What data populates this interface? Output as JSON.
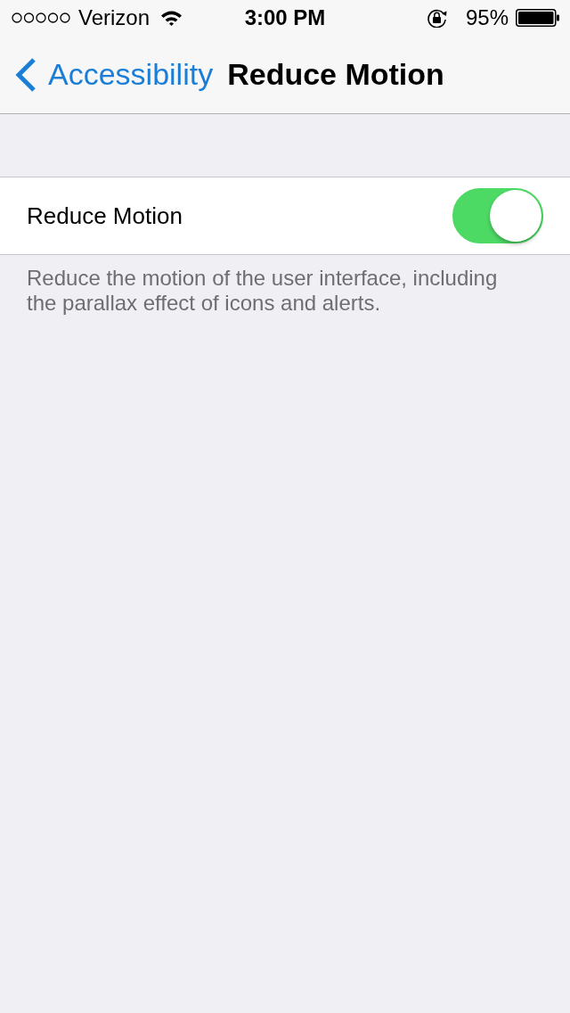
{
  "status_bar": {
    "carrier": "Verizon",
    "time": "3:00 PM",
    "battery_percent": "95%"
  },
  "nav_bar": {
    "back_label": "Accessibility",
    "title": "Reduce Motion"
  },
  "settings": [
    {
      "kind": "toggle",
      "label": "Reduce Motion",
      "on": true
    }
  ],
  "footer": "Reduce the motion of the user interface, including the parallax effect of icons and alerts."
}
